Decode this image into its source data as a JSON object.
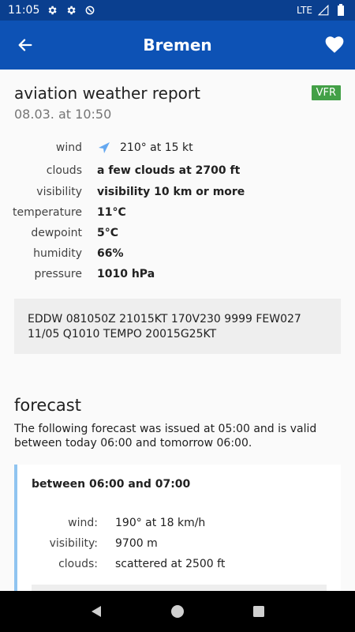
{
  "status_bar": {
    "time": "11:05",
    "network": "LTE",
    "icons": [
      "gear-icon",
      "gear-icon",
      "sync-icon",
      "signal-icon",
      "battery-icon"
    ]
  },
  "app_bar": {
    "title": "Bremen",
    "back_icon": "arrow-left-icon",
    "favorite_icon": "heart-icon"
  },
  "report": {
    "title": "aviation weather report",
    "time": "08.03. at 10:50",
    "flight_rules": "VFR",
    "rows": [
      {
        "label": "wind",
        "value": "210° at 15 kt"
      },
      {
        "label": "clouds",
        "value": "a few clouds at 2700 ft"
      },
      {
        "label": "visibility",
        "value": "visibility 10 km or more"
      },
      {
        "label": "temperature",
        "value": "11°C"
      },
      {
        "label": "dewpoint",
        "value": "5°C"
      },
      {
        "label": "humidity",
        "value": "66%"
      },
      {
        "label": "pressure",
        "value": "1010 hPa"
      }
    ],
    "metar_line1": "EDDW 081050Z 21015KT 170V230 9999 FEW027",
    "metar_line2": "11/05 Q1010 TEMPO 20015G25KT"
  },
  "forecast": {
    "title": "forecast",
    "description": "The following forecast was issued at 05:00 and is valid between today 06:00 and tomorrow 06:00.",
    "periods": [
      {
        "period": "between 06:00 and 07:00",
        "rows": [
          {
            "label": "wind:",
            "value": "190° at 18 km/h"
          },
          {
            "label": "visibility:",
            "value": "9700 m"
          },
          {
            "label": "clouds:",
            "value": "scattered at 2500 ft"
          }
        ]
      }
    ]
  },
  "colors": {
    "status_bar": "#0a3f8f",
    "app_bar": "#0d52b5",
    "vfr_badge": "#43a047",
    "wind_arrow": "#64a8f0",
    "forecast_accent": "#90c4f0"
  },
  "nav_bar": {
    "icons": [
      "back-triangle-icon",
      "home-circle-icon",
      "recents-square-icon"
    ]
  }
}
